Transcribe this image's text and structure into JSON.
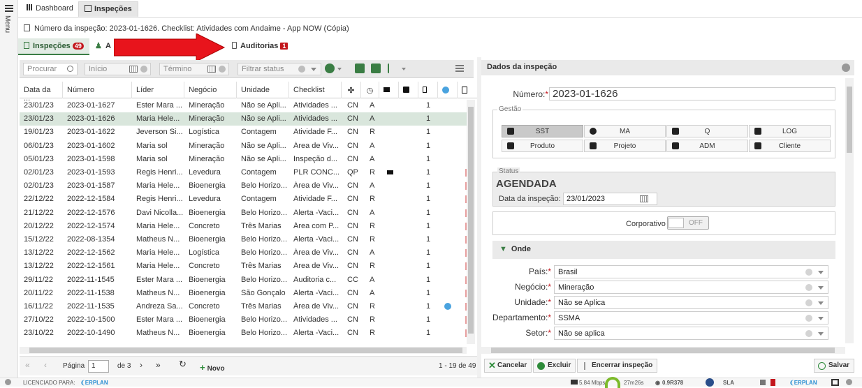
{
  "rail": {
    "menu_label": "Menu"
  },
  "top_tabs": [
    {
      "label": "Dashboard"
    },
    {
      "label": "Inspeções"
    }
  ],
  "title": "Número da inspeção: 2023-01-1626. Checklist: Atividades com Andaime - App NOW (Cópia)",
  "sub_tabs": {
    "inspecoes": {
      "label": "Inspeções",
      "count": "49"
    },
    "a": {
      "label": "A"
    },
    "auditorias": {
      "label": "Auditorias",
      "count": "1"
    }
  },
  "toolbar": {
    "search_placeholder": "Procurar",
    "start_placeholder": "Início",
    "end_placeholder": "Término",
    "status_placeholder": "Filtrar status"
  },
  "table": {
    "headers": [
      "Data da ...",
      "Número",
      "Líder",
      "Negócio",
      "Unidade",
      "Checklist"
    ],
    "rows": [
      [
        "23/01/23",
        "2023-01-1627",
        "Ester Mara ...",
        "Mineração",
        "Não se Apli...",
        "Atividades ...",
        "CN",
        "A",
        "",
        "1"
      ],
      [
        "23/01/23",
        "2023-01-1626",
        "Maria Hele...",
        "Mineração",
        "Não se Apli...",
        "Atividades ...",
        "CN",
        "A",
        "",
        "1"
      ],
      [
        "19/01/23",
        "2023-01-1622",
        "Jeverson Si...",
        "Logística",
        "Contagem",
        "Atividade F...",
        "CN",
        "R",
        "",
        "1"
      ],
      [
        "06/01/23",
        "2023-01-1602",
        "Maria sol",
        "Mineração",
        "Não se Apli...",
        "Área de Viv...",
        "CN",
        "A",
        "",
        "1"
      ],
      [
        "05/01/23",
        "2023-01-1598",
        "Maria sol",
        "Mineração",
        "Não se Apli...",
        "Inspeção d...",
        "CN",
        "A",
        "",
        "1"
      ],
      [
        "02/01/23",
        "2023-01-1593",
        "Regis Henri...",
        "Levedura",
        "Contagem",
        "PLR CONC...",
        "QP",
        "R",
        "flag",
        "1"
      ],
      [
        "02/01/23",
        "2023-01-1587",
        "Maria Hele...",
        "Bioenergia",
        "Belo Horizo...",
        "Área de Viv...",
        "CN",
        "A",
        "",
        "1"
      ],
      [
        "22/12/22",
        "2022-12-1584",
        "Regis Henri...",
        "Levedura",
        "Contagem",
        "Atividade F...",
        "CN",
        "R",
        "",
        "1"
      ],
      [
        "21/12/22",
        "2022-12-1576",
        "Davi Nicolla...",
        "Bioenergia",
        "Belo Horizo...",
        "Alerta -Vaci...",
        "CN",
        "A",
        "",
        "1"
      ],
      [
        "20/12/22",
        "2022-12-1574",
        "Maria Hele...",
        "Concreto",
        "Três Marias",
        "Área com P...",
        "CN",
        "R",
        "",
        "1"
      ],
      [
        "15/12/22",
        "2022-08-1354",
        "Matheus N...",
        "Bioenergia",
        "Belo Horizo...",
        "Alerta -Vaci...",
        "CN",
        "R",
        "",
        "1"
      ],
      [
        "13/12/22",
        "2022-12-1562",
        "Maria Hele...",
        "Logística",
        "Belo Horizo...",
        "Área de Viv...",
        "CN",
        "A",
        "",
        "1"
      ],
      [
        "13/12/22",
        "2022-12-1561",
        "Maria Hele...",
        "Concreto",
        "Três Marias",
        "Área de Viv...",
        "CN",
        "R",
        "",
        "1"
      ],
      [
        "29/11/22",
        "2022-11-1545",
        "Ester Mara ...",
        "Bioenergia",
        "Belo Horizo...",
        "Auditoria c...",
        "CC",
        "A",
        "",
        "1"
      ],
      [
        "20/11/22",
        "2022-11-1538",
        "Matheus N...",
        "Bioenergia",
        "São Gonçalo",
        "Alerta -Vaci...",
        "CN",
        "A",
        "",
        "1"
      ],
      [
        "16/11/22",
        "2022-11-1535",
        "Andreza Sa...",
        "Concreto",
        "Três Marias",
        "Área de Viv...",
        "CN",
        "R",
        "",
        "1"
      ],
      [
        "27/10/22",
        "2022-10-1500",
        "Ester Mara ...",
        "Bioenergia",
        "Belo Horizo...",
        "Atividades ...",
        "CN",
        "R",
        "",
        "1"
      ],
      [
        "23/10/22",
        "2022-10-1490",
        "Matheus N...",
        "Bioenergia",
        "Belo Horizo...",
        "Alerta -Vaci...",
        "CN",
        "R",
        "",
        "1"
      ]
    ]
  },
  "pager": {
    "page_label": "Página",
    "page_value": "1",
    "of_label": "de 3",
    "new_label": "Novo",
    "range": "1 - 19 de 49"
  },
  "right": {
    "header": "Dados da inspeção",
    "numero_label": "Número:",
    "numero_value": "2023-01-1626",
    "gestao_legend": "Gestão",
    "gestao_buttons": [
      "SST",
      "MA",
      "Q",
      "LOG",
      "Produto",
      "Projeto",
      "ADM",
      "Cliente"
    ],
    "status_legend": "Status",
    "status_value": "AGENDADA",
    "data_label": "Data da inspeção:",
    "data_value": "23/01/2023",
    "corporativo_label": "Corporativo",
    "toggle_label": "OFF",
    "onde_title": "Onde",
    "fields": [
      {
        "label": "País:",
        "value": "Brasil"
      },
      {
        "label": "Negócio:",
        "value": "Mineração"
      },
      {
        "label": "Unidade:",
        "value": "Não se Aplica"
      },
      {
        "label": "Departamento:",
        "value": "SSMA"
      },
      {
        "label": "Setor:",
        "value": "Não se aplica"
      }
    ]
  },
  "actions": {
    "cancel": "Cancelar",
    "delete": "Excluir",
    "close": "Encerrar inspeção",
    "save": "Salvar"
  },
  "statusbar": {
    "licensed_label": "LICENCIADO PARA:",
    "brand": "ERPLAN",
    "speed": "5.84 Mbps",
    "timer": "27m26s",
    "version": "0.9R378",
    "sla": "SLA"
  },
  "colors": {
    "accent_green": "#3a7d44",
    "badge_red": "#c3161c",
    "arrow_red": "#e8141c"
  }
}
